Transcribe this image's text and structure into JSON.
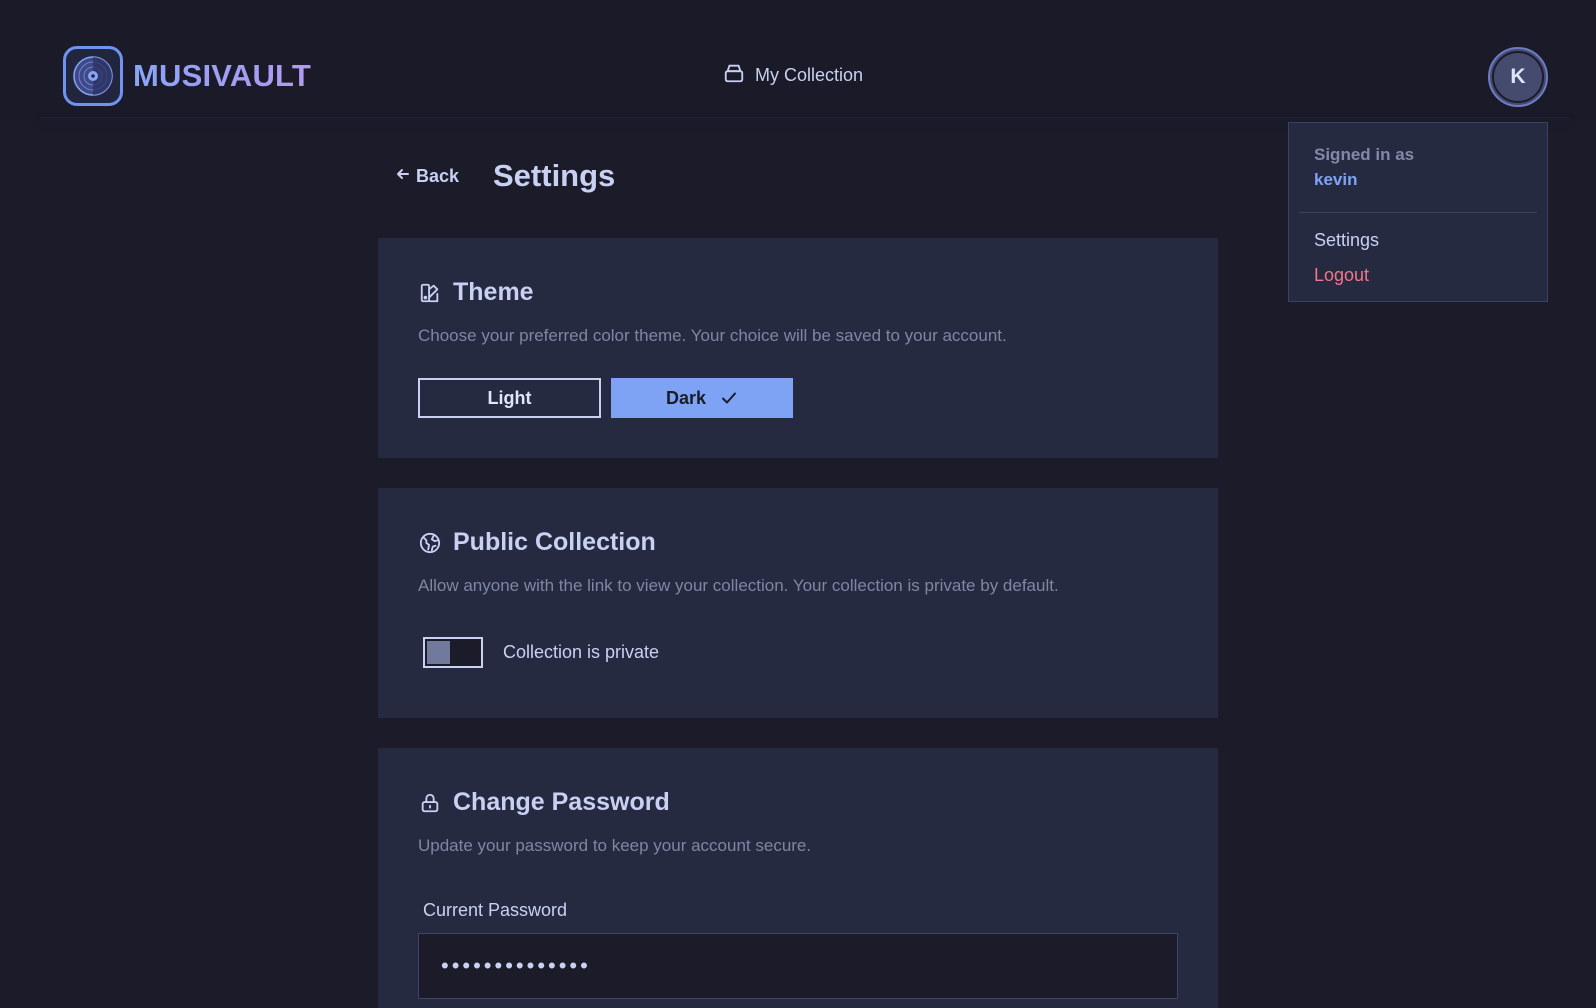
{
  "header": {
    "brand": "MUSIVAULT",
    "nav_collection": "My Collection",
    "avatar_initial": "K"
  },
  "user_menu": {
    "signed_in_as": "Signed in as",
    "username": "kevin",
    "settings": "Settings",
    "logout": "Logout"
  },
  "page": {
    "back": "Back",
    "title": "Settings"
  },
  "theme": {
    "title": "Theme",
    "description": "Choose your preferred color theme. Your choice will be saved to your account.",
    "light_label": "Light",
    "dark_label": "Dark",
    "selected": "Dark"
  },
  "public_collection": {
    "title": "Public Collection",
    "description": "Allow anyone with the link to view your collection. Your collection is private by default.",
    "toggle_label": "Collection is private",
    "is_public": false
  },
  "change_password": {
    "title": "Change Password",
    "description": "Update your password to keep your account secure.",
    "current_label": "Current Password",
    "current_value": "••••••••••••••"
  },
  "colors": {
    "background": "#1b1b2a",
    "card": "#252a40",
    "accent": "#7ea3f5",
    "danger": "#f0768a",
    "muted": "#7f86a4"
  }
}
